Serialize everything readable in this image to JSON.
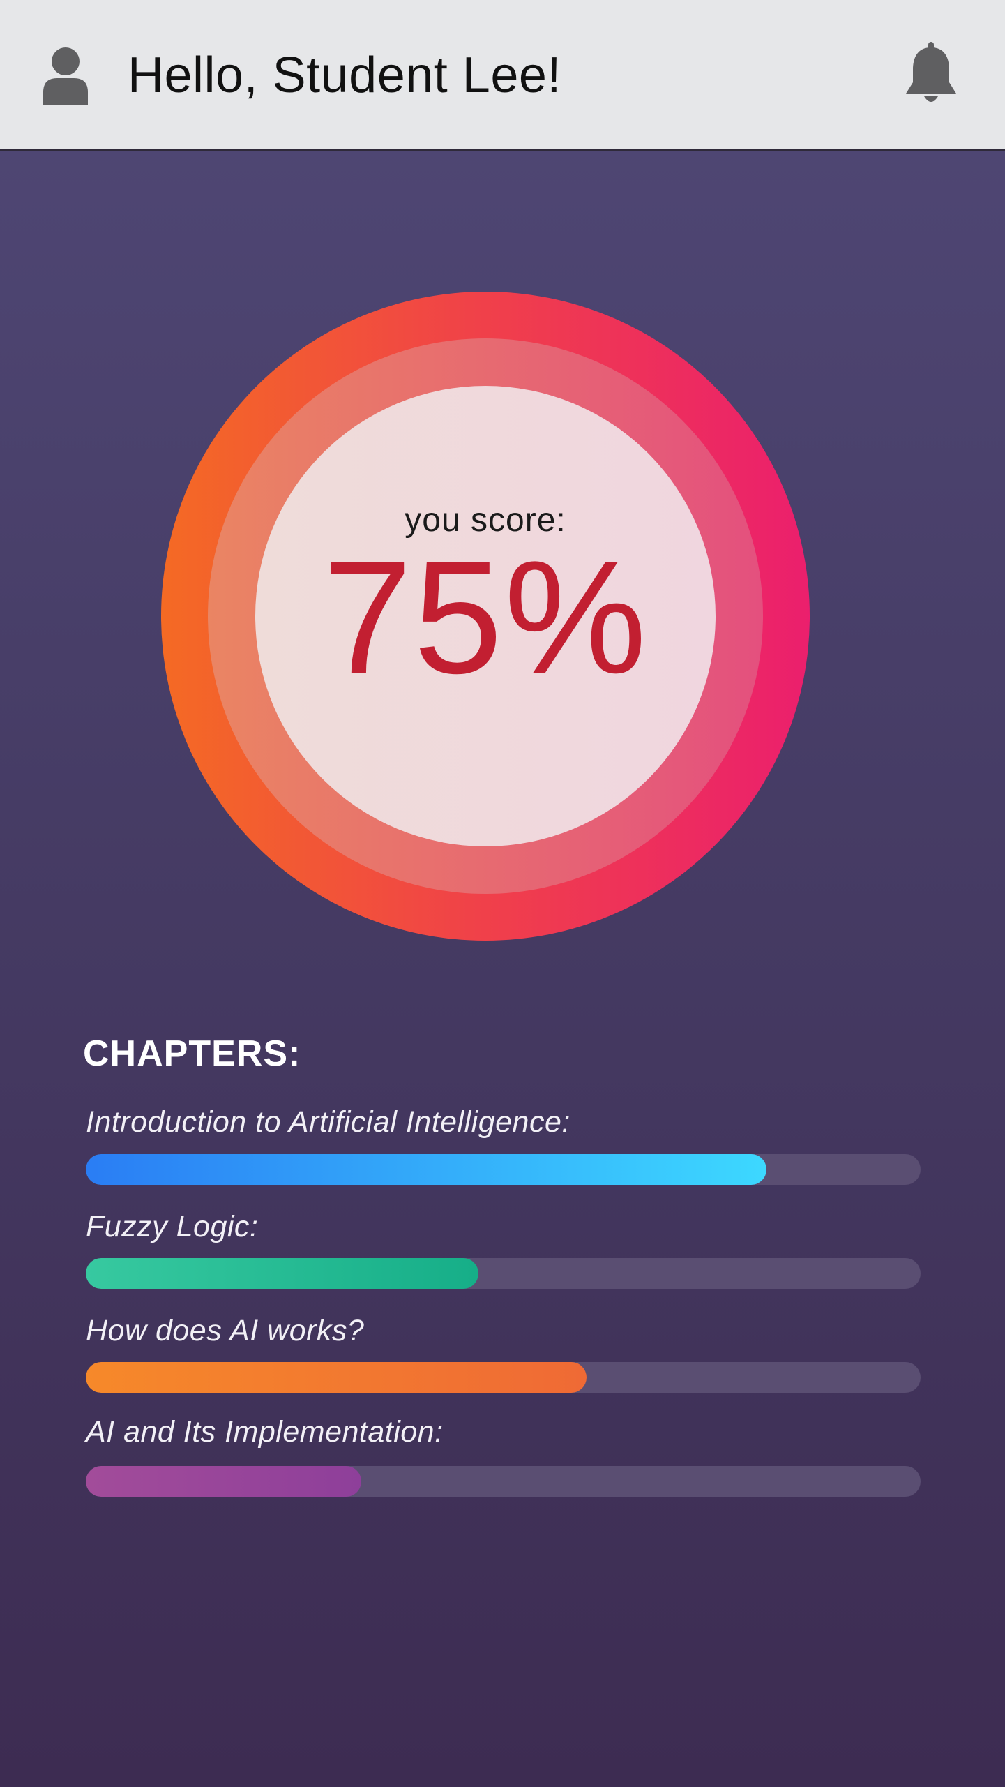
{
  "header": {
    "greeting": "Hello, Student Lee!",
    "avatar_icon": "user-icon",
    "notification_icon": "bell-icon"
  },
  "score": {
    "label": "you score:",
    "value_text": "75%",
    "value": 0.75
  },
  "chapters": {
    "title": "CHAPTERS:",
    "items": [
      {
        "label": "Introduction to Artificial Intelligence:",
        "progress": 0.815,
        "color_start": "#2a7df4",
        "color_end": "#3dd8ff"
      },
      {
        "label": "Fuzzy Logic:",
        "progress": 0.47,
        "color_start": "#37c9a0",
        "color_end": "#16ae88"
      },
      {
        "label": "How does AI works?",
        "progress": 0.6,
        "color_start": "#f6892a",
        "color_end": "#ef6a35"
      },
      {
        "label": "AI and Its Implementation:",
        "progress": 0.33,
        "color_start": "#a24c9a",
        "color_end": "#8e3f9a"
      }
    ]
  },
  "colors": {
    "score_text": "#c21f31",
    "ring_start": "#f46a2a",
    "ring_end": "#eb1f6d",
    "header_bg": "#e6e7e9",
    "track": "#5a4e72"
  }
}
